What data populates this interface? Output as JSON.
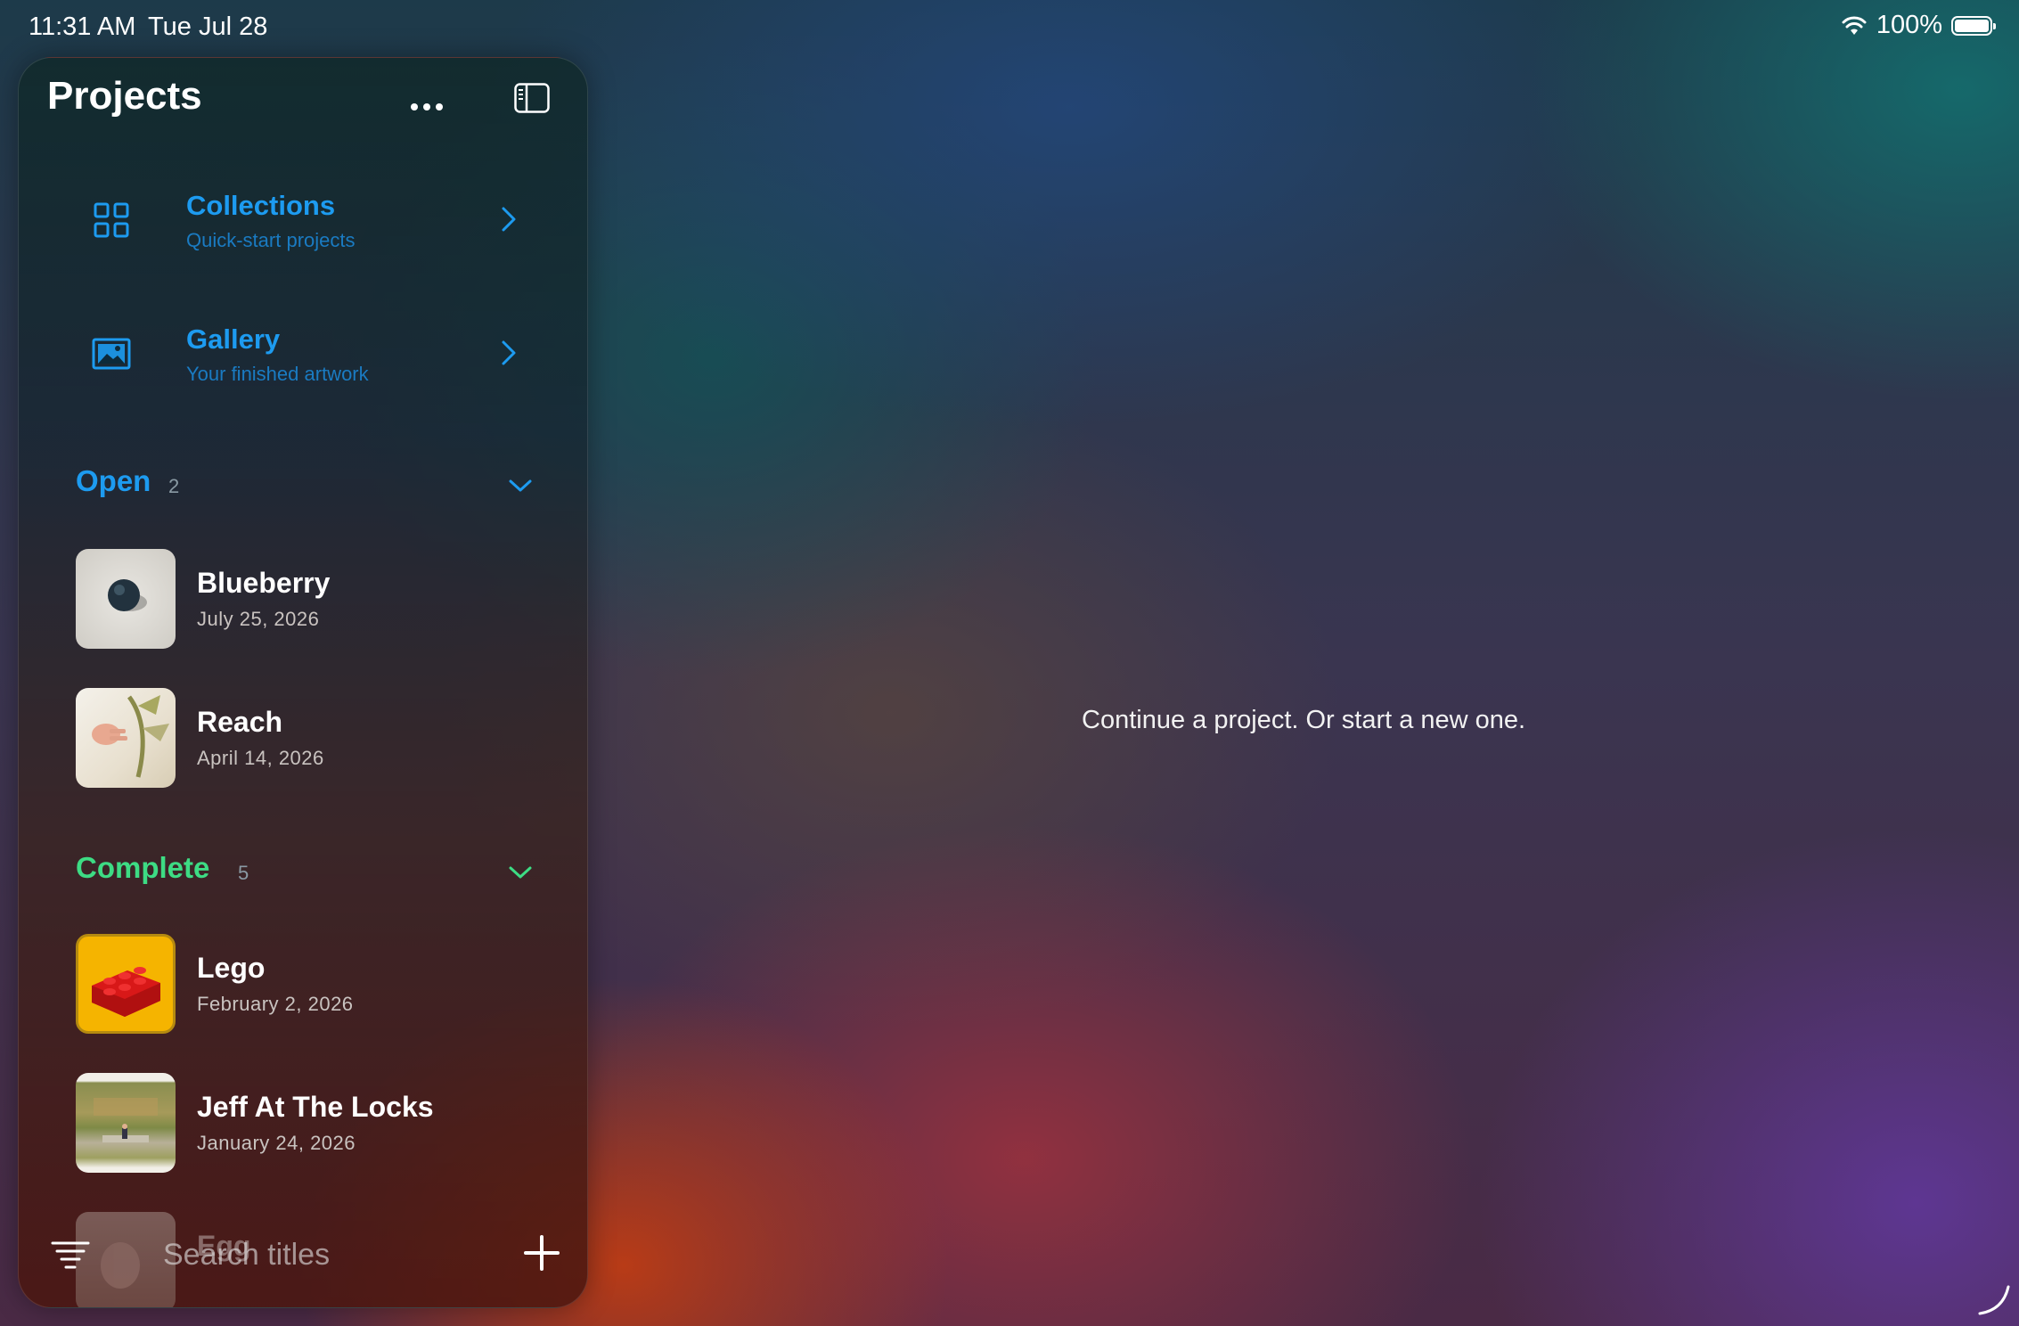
{
  "status_bar": {
    "time": "11:31 AM",
    "date": "Tue Jul 28",
    "battery": "100%"
  },
  "sidebar": {
    "title": "Projects",
    "nav": [
      {
        "title": "Collections",
        "subtitle": "Quick-start projects",
        "icon": "grid-icon"
      },
      {
        "title": "Gallery",
        "subtitle": "Your finished artwork",
        "icon": "photo-icon"
      }
    ],
    "sections": {
      "open": {
        "title": "Open",
        "count": "2",
        "color": "#1d9bf0",
        "items": [
          {
            "title": "Blueberry",
            "date": "July 25, 2026"
          },
          {
            "title": "Reach",
            "date": "April 14, 2026"
          }
        ]
      },
      "complete": {
        "title": "Complete",
        "count": "5",
        "color": "#3ddc84",
        "items": [
          {
            "title": "Lego",
            "date": "February 2, 2026"
          },
          {
            "title": "Jeff At The Locks",
            "date": "January 24, 2026"
          },
          {
            "title": "Egg",
            "date": ""
          }
        ]
      }
    },
    "search": {
      "placeholder": "Search titles"
    }
  },
  "main": {
    "message": "Continue a project. Or start a new one."
  },
  "colors": {
    "accent_blue": "#1d9bf0",
    "accent_green": "#3ddc84"
  }
}
